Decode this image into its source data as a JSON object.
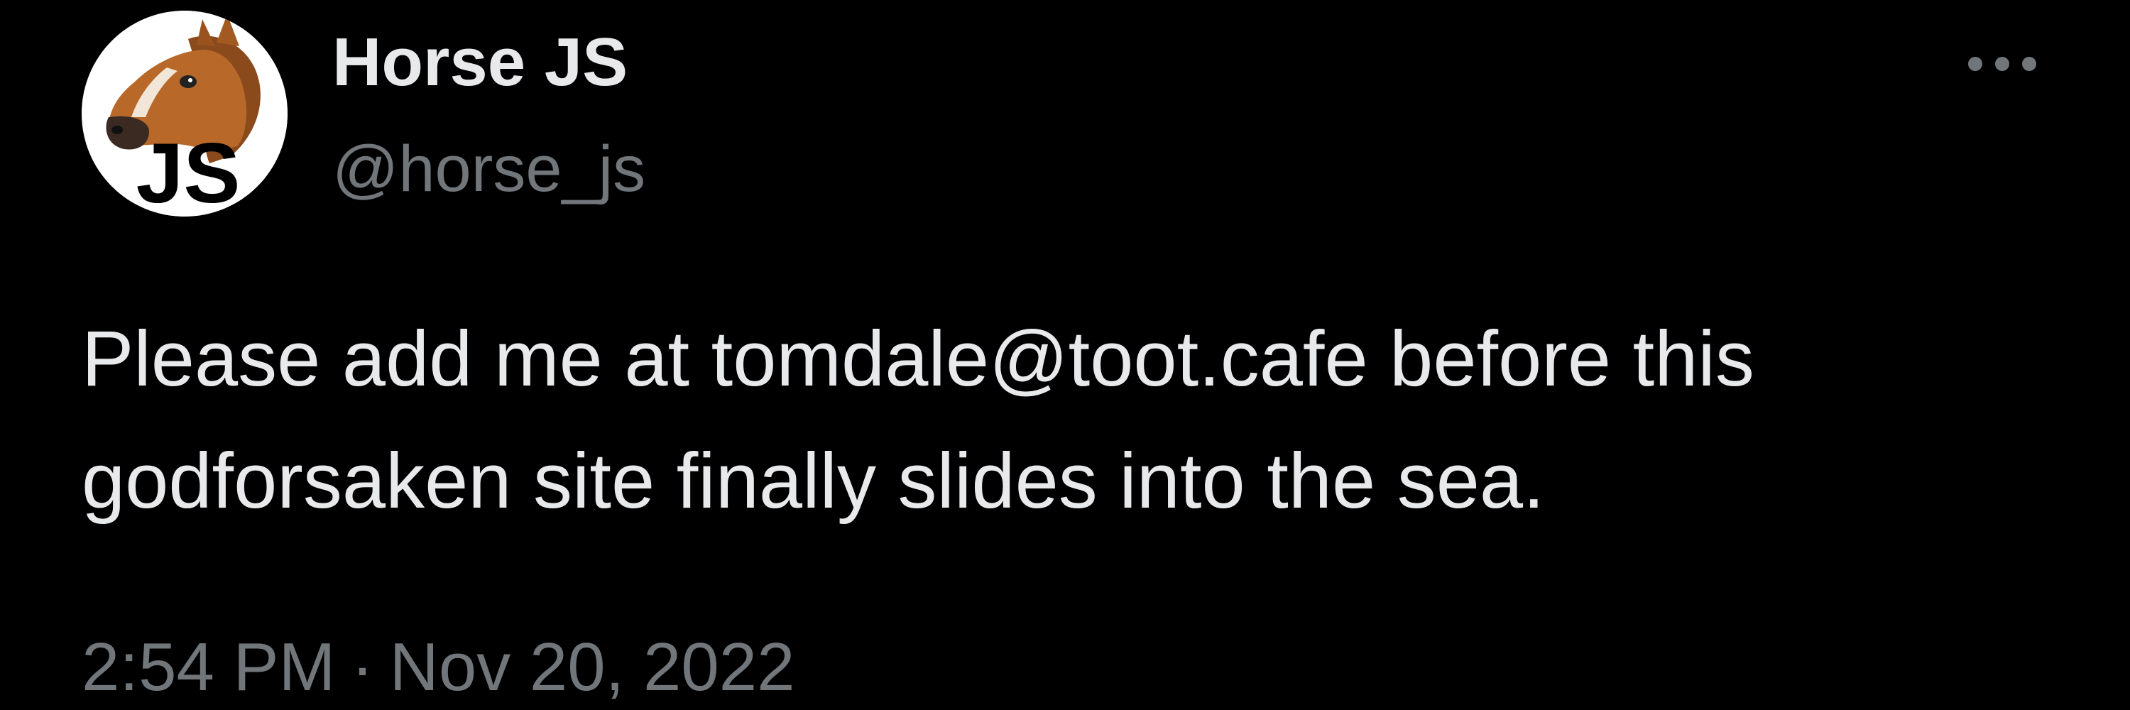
{
  "author": {
    "display_name": "Horse JS",
    "handle": "@horse_js",
    "avatar_icon": "horse-head-js-avatar",
    "avatar_text": "JS"
  },
  "menu": {
    "more_icon": "more-horizontal-icon"
  },
  "tweet": {
    "lines": [
      "Please add me at tomdale@toot.cafe before this",
      "godforsaken site finally slides into the sea."
    ]
  },
  "meta": {
    "time": "2:54 PM",
    "separator": "·",
    "date": "Nov 20, 2022"
  },
  "colors": {
    "background": "#000000",
    "primary_text": "#e7e9ea",
    "secondary_text": "#71767b"
  }
}
